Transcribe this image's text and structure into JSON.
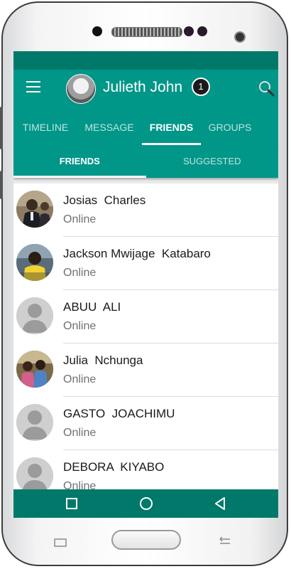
{
  "app_bar": {
    "profile_name": "Julieth John",
    "notification_count": "1"
  },
  "tabs": [
    {
      "label": "TIMELINE",
      "active": false
    },
    {
      "label": "MESSAGE",
      "active": false
    },
    {
      "label": "FRIENDS",
      "active": true
    },
    {
      "label": "GROUPS",
      "active": false
    }
  ],
  "subtabs": [
    {
      "label": "FRIENDS",
      "active": true
    },
    {
      "label": "SUGGESTED",
      "active": false
    }
  ],
  "friends": [
    {
      "name": "Josias  Charles",
      "status": "Online",
      "avatar": "photo-man-suit"
    },
    {
      "name": "Jackson Mwijage  Katabaro",
      "status": "Online",
      "avatar": "photo-man-yellow"
    },
    {
      "name": "ABUU  ALI",
      "status": "Online",
      "avatar": "default-person-icon"
    },
    {
      "name": "Julia  Nchunga",
      "status": "Online",
      "avatar": "photo-group"
    },
    {
      "name": "GASTO  JOACHIMU",
      "status": "Online",
      "avatar": "default-person-icon"
    },
    {
      "name": "DEBORA  KIYABO",
      "status": "Online",
      "avatar": "default-person-icon"
    }
  ],
  "colors": {
    "primary": "#009688",
    "primary_dark": "#00796b",
    "status_text": "#707070"
  }
}
